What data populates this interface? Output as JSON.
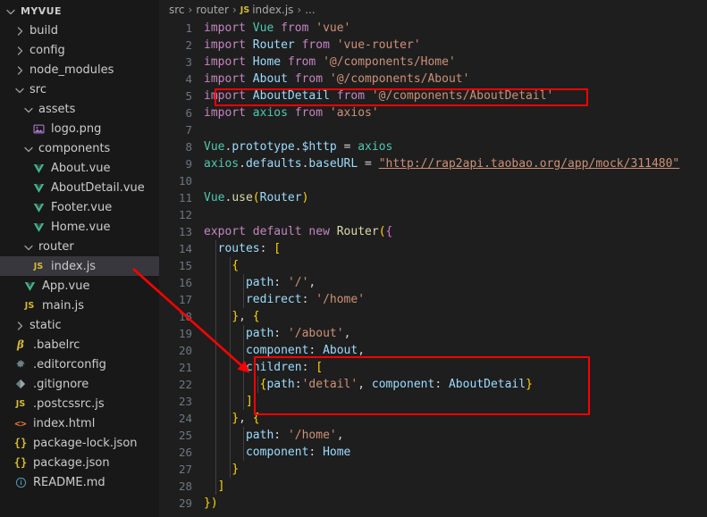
{
  "window": {
    "theme": "vscode-dark",
    "background": "#1e1e1e",
    "sidebar_background": "#181818",
    "accent_annotation_color": "#ff0000",
    "selected_row_color": "#37373d"
  },
  "sidebar": {
    "root_label": "MYVUE",
    "items": [
      {
        "label": "MYVUE",
        "indent": 0,
        "type": "root",
        "icon": "chevron-down-icon",
        "expanded": true,
        "selected": false
      },
      {
        "label": "build",
        "indent": 1,
        "type": "folder",
        "icon": "chevron-right-icon",
        "expanded": false,
        "selected": false
      },
      {
        "label": "config",
        "indent": 1,
        "type": "folder",
        "icon": "chevron-right-icon",
        "expanded": false,
        "selected": false
      },
      {
        "label": "node_modules",
        "indent": 1,
        "type": "folder",
        "icon": "chevron-right-icon",
        "expanded": false,
        "selected": false
      },
      {
        "label": "src",
        "indent": 1,
        "type": "folder",
        "icon": "chevron-down-icon",
        "expanded": true,
        "selected": false
      },
      {
        "label": "assets",
        "indent": 2,
        "type": "folder",
        "icon": "chevron-down-icon",
        "expanded": true,
        "selected": false
      },
      {
        "label": "logo.png",
        "indent": 3,
        "type": "image",
        "icon": "image-file-icon",
        "expanded": false,
        "selected": false
      },
      {
        "label": "components",
        "indent": 2,
        "type": "folder",
        "icon": "chevron-down-icon",
        "expanded": true,
        "selected": false
      },
      {
        "label": "About.vue",
        "indent": 3,
        "type": "vue",
        "icon": "vue-file-icon",
        "expanded": false,
        "selected": false
      },
      {
        "label": "AboutDetail.vue",
        "indent": 3,
        "type": "vue",
        "icon": "vue-file-icon",
        "expanded": false,
        "selected": false
      },
      {
        "label": "Footer.vue",
        "indent": 3,
        "type": "vue",
        "icon": "vue-file-icon",
        "expanded": false,
        "selected": false
      },
      {
        "label": "Home.vue",
        "indent": 3,
        "type": "vue",
        "icon": "vue-file-icon",
        "expanded": false,
        "selected": false
      },
      {
        "label": "router",
        "indent": 2,
        "type": "folder",
        "icon": "chevron-down-icon",
        "expanded": true,
        "selected": false
      },
      {
        "label": "index.js",
        "indent": 3,
        "type": "js",
        "icon": "js-file-icon",
        "expanded": false,
        "selected": true
      },
      {
        "label": "App.vue",
        "indent": 2,
        "type": "vue",
        "icon": "vue-file-icon",
        "expanded": false,
        "selected": false
      },
      {
        "label": "main.js",
        "indent": 2,
        "type": "js",
        "icon": "js-file-icon",
        "expanded": false,
        "selected": false
      },
      {
        "label": "static",
        "indent": 1,
        "type": "folder",
        "icon": "chevron-right-icon",
        "expanded": false,
        "selected": false
      },
      {
        "label": ".babelrc",
        "indent": 1,
        "type": "babel",
        "icon": "babel-file-icon",
        "expanded": false,
        "selected": false
      },
      {
        "label": ".editorconfig",
        "indent": 1,
        "type": "config",
        "icon": "gear-icon",
        "expanded": false,
        "selected": false
      },
      {
        "label": ".gitignore",
        "indent": 1,
        "type": "git",
        "icon": "git-file-icon",
        "expanded": false,
        "selected": false
      },
      {
        "label": ".postcssrc.js",
        "indent": 1,
        "type": "js",
        "icon": "js-file-icon",
        "expanded": false,
        "selected": false
      },
      {
        "label": "index.html",
        "indent": 1,
        "type": "html",
        "icon": "html-file-icon",
        "expanded": false,
        "selected": false
      },
      {
        "label": "package-lock.json",
        "indent": 1,
        "type": "json",
        "icon": "json-file-icon",
        "expanded": false,
        "selected": false
      },
      {
        "label": "package.json",
        "indent": 1,
        "type": "json",
        "icon": "json-file-icon",
        "expanded": false,
        "selected": false
      },
      {
        "label": "README.md",
        "indent": 1,
        "type": "markdown",
        "icon": "info-file-icon",
        "expanded": false,
        "selected": false
      }
    ]
  },
  "breadcrumb": {
    "segments": [
      "src",
      "router",
      "index.js",
      "..."
    ],
    "separator": "›",
    "file_icon": "JS"
  },
  "editor": {
    "filename": "index.js",
    "language": "javascript",
    "first_line": 1,
    "last_line": 29,
    "lines": [
      {
        "n": "1",
        "text": "import Vue from 'vue'"
      },
      {
        "n": "2",
        "text": "import Router from 'vue-router'"
      },
      {
        "n": "3",
        "text": "import Home from '@/components/Home'"
      },
      {
        "n": "4",
        "text": "import About from '@/components/About'"
      },
      {
        "n": "5",
        "text": "import AboutDetail from '@/components/AboutDetail'"
      },
      {
        "n": "6",
        "text": "import axios from 'axios'"
      },
      {
        "n": "7",
        "text": ""
      },
      {
        "n": "8",
        "text": "Vue.prototype.$http = axios"
      },
      {
        "n": "9",
        "text": "axios.defaults.baseURL = \"http://rap2api.taobao.org/app/mock/311480\""
      },
      {
        "n": "10",
        "text": ""
      },
      {
        "n": "11",
        "text": "Vue.use(Router)"
      },
      {
        "n": "12",
        "text": ""
      },
      {
        "n": "13",
        "text": "export default new Router({"
      },
      {
        "n": "14",
        "text": "  routes: ["
      },
      {
        "n": "15",
        "text": "    {"
      },
      {
        "n": "16",
        "text": "      path: '/',"
      },
      {
        "n": "17",
        "text": "      redirect: '/home'"
      },
      {
        "n": "18",
        "text": "    }, {"
      },
      {
        "n": "19",
        "text": "      path: '/about',"
      },
      {
        "n": "20",
        "text": "      component: About,"
      },
      {
        "n": "21",
        "text": "      children: ["
      },
      {
        "n": "22",
        "text": "        {path:'detail', component: AboutDetail}"
      },
      {
        "n": "23",
        "text": "      ]"
      },
      {
        "n": "24",
        "text": "    }, {"
      },
      {
        "n": "25",
        "text": "      path: '/home',"
      },
      {
        "n": "26",
        "text": "      component: Home"
      },
      {
        "n": "27",
        "text": "    }"
      },
      {
        "n": "28",
        "text": "  ]"
      },
      {
        "n": "29",
        "text": "})"
      }
    ]
  },
  "annotations": {
    "highlight_boxes": [
      {
        "name": "import-aboutdetail-highlight",
        "target_line": "5",
        "color": "#ff0000"
      },
      {
        "name": "children-routes-highlight",
        "target_line": "21-23",
        "color": "#ff0000"
      }
    ],
    "arrow": {
      "name": "index-js-to-children-arrow",
      "from": "index.js sidebar entry",
      "to": "children route block",
      "color": "#ff0000"
    }
  }
}
